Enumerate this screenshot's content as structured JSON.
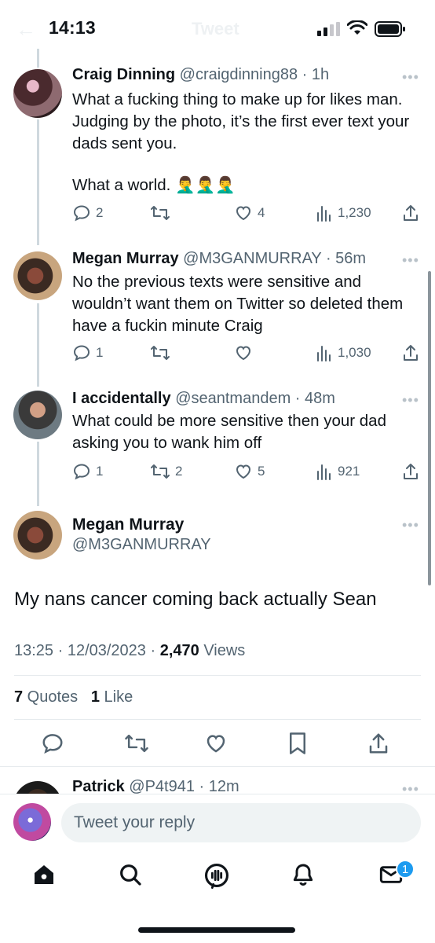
{
  "status_bar": {
    "time": "14:13",
    "ghost_title": "Tweet"
  },
  "tweets": [
    {
      "name": "Craig Dinning",
      "handle": "@craigdinning88 · 1h",
      "text": "What a fucking thing to make up for likes man. Judging by the photo, it’s the first ever text your dads sent you.",
      "text2": "What a world. 🤦‍♂️🤦‍♂️🤦‍♂️",
      "replies": "2",
      "retweets": "",
      "likes": "4",
      "views": "1,230"
    },
    {
      "name": "Megan Murray",
      "handle": "@M3GANMURRAY · 56m",
      "text": "No the previous texts were sensitive and wouldn’t want them on Twitter so deleted them have a fuckin minute Craig",
      "replies": "1",
      "retweets": "",
      "likes": "",
      "views": "1,030"
    },
    {
      "name": "I accidentally",
      "handle": "@seantmandem · 48m",
      "text": "What could be more sensitive then your dad asking you to wank him off",
      "replies": "1",
      "retweets": "2",
      "likes": "5",
      "views": "921"
    }
  ],
  "main_tweet": {
    "name": "Megan Murray",
    "handle": "@M3GANMURRAY",
    "text": "My nans cancer coming back actually Sean",
    "time": "13:25 · 12/03/2023 · ",
    "views_count": "2,470",
    "views_label": " Views",
    "quotes_count": "7",
    "quotes_label": " Quotes",
    "likes_count": "1",
    "likes_label": " Like"
  },
  "next_reply": {
    "name": "Patrick",
    "handle": "@P4t941 · 12m"
  },
  "reply_box": {
    "placeholder": "Tweet your reply"
  },
  "notifications_badge": "1",
  "colors": {
    "accent": "#1d9bf0",
    "text": "#0f1419",
    "muted": "#536471"
  }
}
